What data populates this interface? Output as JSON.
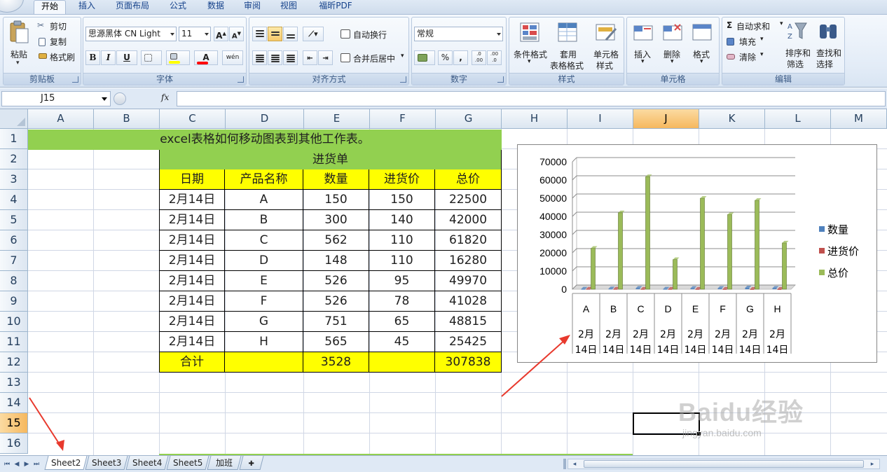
{
  "ribbon": {
    "tabs": [
      "开始",
      "插入",
      "页面布局",
      "公式",
      "数据",
      "审阅",
      "视图",
      "福昕PDF"
    ],
    "active_tab": "开始",
    "clipboard": {
      "paste": "粘贴",
      "cut": "剪切",
      "copy": "复制",
      "format_painter": "格式刷",
      "label": "剪贴板"
    },
    "font": {
      "name": "思源黑体 CN Light",
      "size": "11",
      "grow": "A",
      "shrink": "A",
      "bold": "B",
      "italic": "I",
      "underline": "U",
      "font_color_letter": "A",
      "phonetic": "wén",
      "label": "字体"
    },
    "alignment": {
      "wrap": "自动换行",
      "merge": "合并后居中",
      "label": "对齐方式"
    },
    "number": {
      "format": "常规",
      "percent": "%",
      "comma": ",",
      "inc_decimal": ".0 .00",
      "dec_decimal": ".00 .0",
      "label": "数字"
    },
    "styles": {
      "conditional": [
        "条件格式"
      ],
      "table": [
        "套用",
        "表格格式"
      ],
      "cell": [
        "单元格",
        "样式"
      ],
      "label": "样式"
    },
    "cells": {
      "insert": "插入",
      "delete": "删除",
      "format": "格式",
      "label": "单元格"
    },
    "editing": {
      "autosum": "自动求和",
      "fill": "填充",
      "clear": "清除",
      "sort": [
        "排序和",
        "筛选"
      ],
      "find": [
        "查找和",
        "选择"
      ],
      "label": "编辑"
    }
  },
  "formula_bar": {
    "name_box": "J15",
    "fx": "fx",
    "formula": ""
  },
  "columns": [
    "A",
    "B",
    "C",
    "D",
    "E",
    "F",
    "G",
    "H",
    "I",
    "J",
    "K",
    "L",
    "M"
  ],
  "selected_column": "J",
  "rows": [
    "1",
    "2",
    "3",
    "4",
    "5",
    "6",
    "7",
    "8",
    "9",
    "10",
    "11",
    "12",
    "13",
    "14",
    "15",
    "16"
  ],
  "selected_row": "15",
  "sheet": {
    "title": "excel表格如何移动图表到其他工作表。",
    "table_title": "进货单",
    "headers": [
      "日期",
      "产品名称",
      "数量",
      "进货价",
      "总价"
    ],
    "data": [
      [
        "2月14日",
        "A",
        "150",
        "150",
        "22500"
      ],
      [
        "2月14日",
        "B",
        "300",
        "140",
        "42000"
      ],
      [
        "2月14日",
        "C",
        "562",
        "110",
        "61820"
      ],
      [
        "2月14日",
        "D",
        "148",
        "110",
        "16280"
      ],
      [
        "2月14日",
        "E",
        "526",
        "95",
        "49970"
      ],
      [
        "2月14日",
        "F",
        "526",
        "78",
        "41028"
      ],
      [
        "2月14日",
        "G",
        "751",
        "65",
        "48815"
      ],
      [
        "2月14日",
        "H",
        "565",
        "45",
        "25425"
      ]
    ],
    "total": [
      "合计",
      "",
      "3528",
      "",
      "307838"
    ]
  },
  "chart_data": {
    "type": "bar",
    "categories": [
      "A",
      "B",
      "C",
      "D",
      "E",
      "F",
      "G",
      "H"
    ],
    "category_dates": [
      "2月",
      "14日"
    ],
    "series": [
      {
        "name": "数量",
        "values": [
          150,
          300,
          562,
          148,
          526,
          526,
          751,
          565
        ],
        "color": "#4f81bd"
      },
      {
        "name": "进货价",
        "values": [
          150,
          140,
          110,
          110,
          95,
          78,
          65,
          45
        ],
        "color": "#c0504d"
      },
      {
        "name": "总价",
        "values": [
          22500,
          42000,
          61820,
          16280,
          49970,
          41028,
          48815,
          25425
        ],
        "color": "#9bbb59"
      }
    ],
    "yticks": [
      "0",
      "10000",
      "20000",
      "30000",
      "40000",
      "50000",
      "60000",
      "70000"
    ],
    "ylim": [
      0,
      70000
    ],
    "legend": "right",
    "grid": true
  },
  "sheet_tabs": [
    "Sheet2",
    "Sheet3",
    "Sheet4",
    "Sheet5",
    "加班"
  ],
  "active_sheet": "Sheet2",
  "watermark": {
    "brand": "Baidu经验",
    "url": "jingyan.baidu.com"
  },
  "colors": {
    "title_fill": "#92d050",
    "header_fill": "#ffff00",
    "selection": "#f6b85e"
  }
}
